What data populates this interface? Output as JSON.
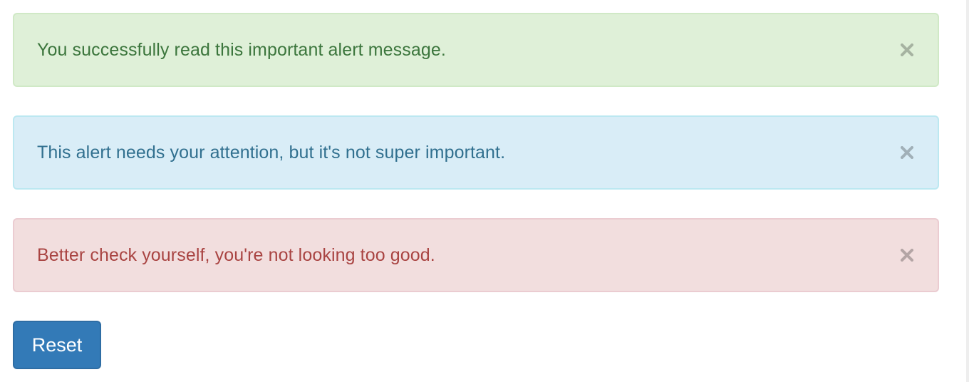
{
  "alerts": [
    {
      "type": "success",
      "message": "You successfully read this important alert message.",
      "close_icon": "close-icon",
      "color": "#3c763d"
    },
    {
      "type": "info",
      "message": "This alert needs your attention, but it's not super important.",
      "close_icon": "close-icon",
      "color": "#31708f"
    },
    {
      "type": "danger",
      "message": "Better check yourself, you're not looking too good.",
      "close_icon": "close-icon",
      "color": "#a94442"
    }
  ],
  "reset_button": {
    "label": "Reset",
    "color": "#337ab7"
  }
}
